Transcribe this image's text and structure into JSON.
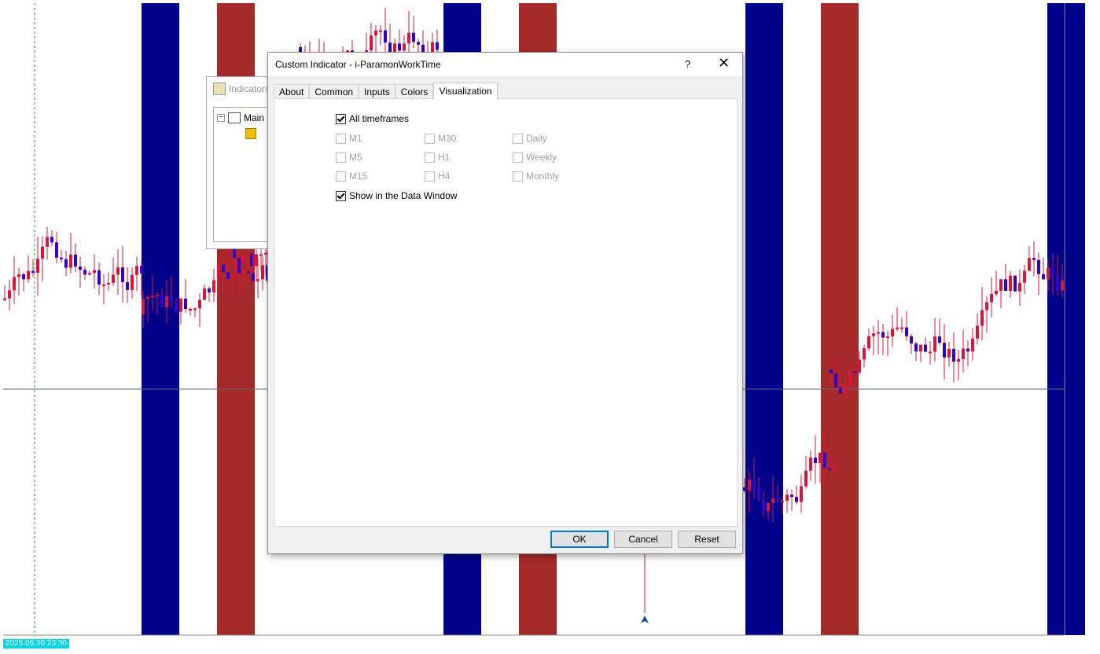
{
  "chart": {
    "colors": {
      "blue_band": "#00008b",
      "red_band": "#a52a2a",
      "bull": "#dc143c",
      "bear": "#3300cc",
      "hline": "#5a6a7a",
      "vline": "#22aa22"
    },
    "status_date": "2025.05.30 23:30"
  },
  "indicators_window": {
    "title": "Indicators",
    "tree_root": "Main"
  },
  "dialog": {
    "title": "Custom Indicator - i-ParamonWorkTime",
    "help": "?",
    "close": "✕",
    "tabs": [
      "About",
      "Common",
      "Inputs",
      "Colors",
      "Visualization"
    ],
    "active_tab": "Visualization",
    "all_timeframes": {
      "label": "All timeframes",
      "checked": true
    },
    "timeframes": [
      [
        "M1",
        "M30",
        "Daily"
      ],
      [
        "M5",
        "H1",
        "Weekly"
      ],
      [
        "M15",
        "H4",
        "Monthly"
      ]
    ],
    "show_data_window": {
      "label": "Show in the Data Window",
      "checked": true
    },
    "buttons": {
      "ok": "OK",
      "cancel": "Cancel",
      "reset": "Reset"
    }
  }
}
